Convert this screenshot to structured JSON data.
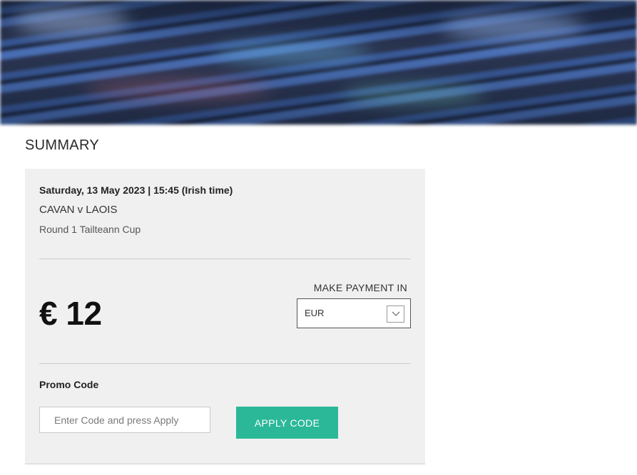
{
  "header": {
    "banner_alt": "stadium-seats-banner"
  },
  "summary": {
    "title": "SUMMARY"
  },
  "event": {
    "date_time": "Saturday, 13 May 2023 | 15:45 (Irish time)",
    "teams": "CAVAN v LAOIS",
    "round": "Round 1 Tailteann Cup"
  },
  "payment": {
    "price": "€ 12",
    "make_payment_label": "MAKE PAYMENT IN",
    "currency_selected": "EUR",
    "currency_icon": "chevron-down-icon"
  },
  "promo": {
    "label": "Promo Code",
    "placeholder": "Enter Code and press Apply",
    "value": "",
    "apply_label": "APPLY CODE"
  },
  "colors": {
    "accent": "#2bb899",
    "card_bg": "#f0f0f0",
    "banner_blue": "#3a5a9a"
  }
}
